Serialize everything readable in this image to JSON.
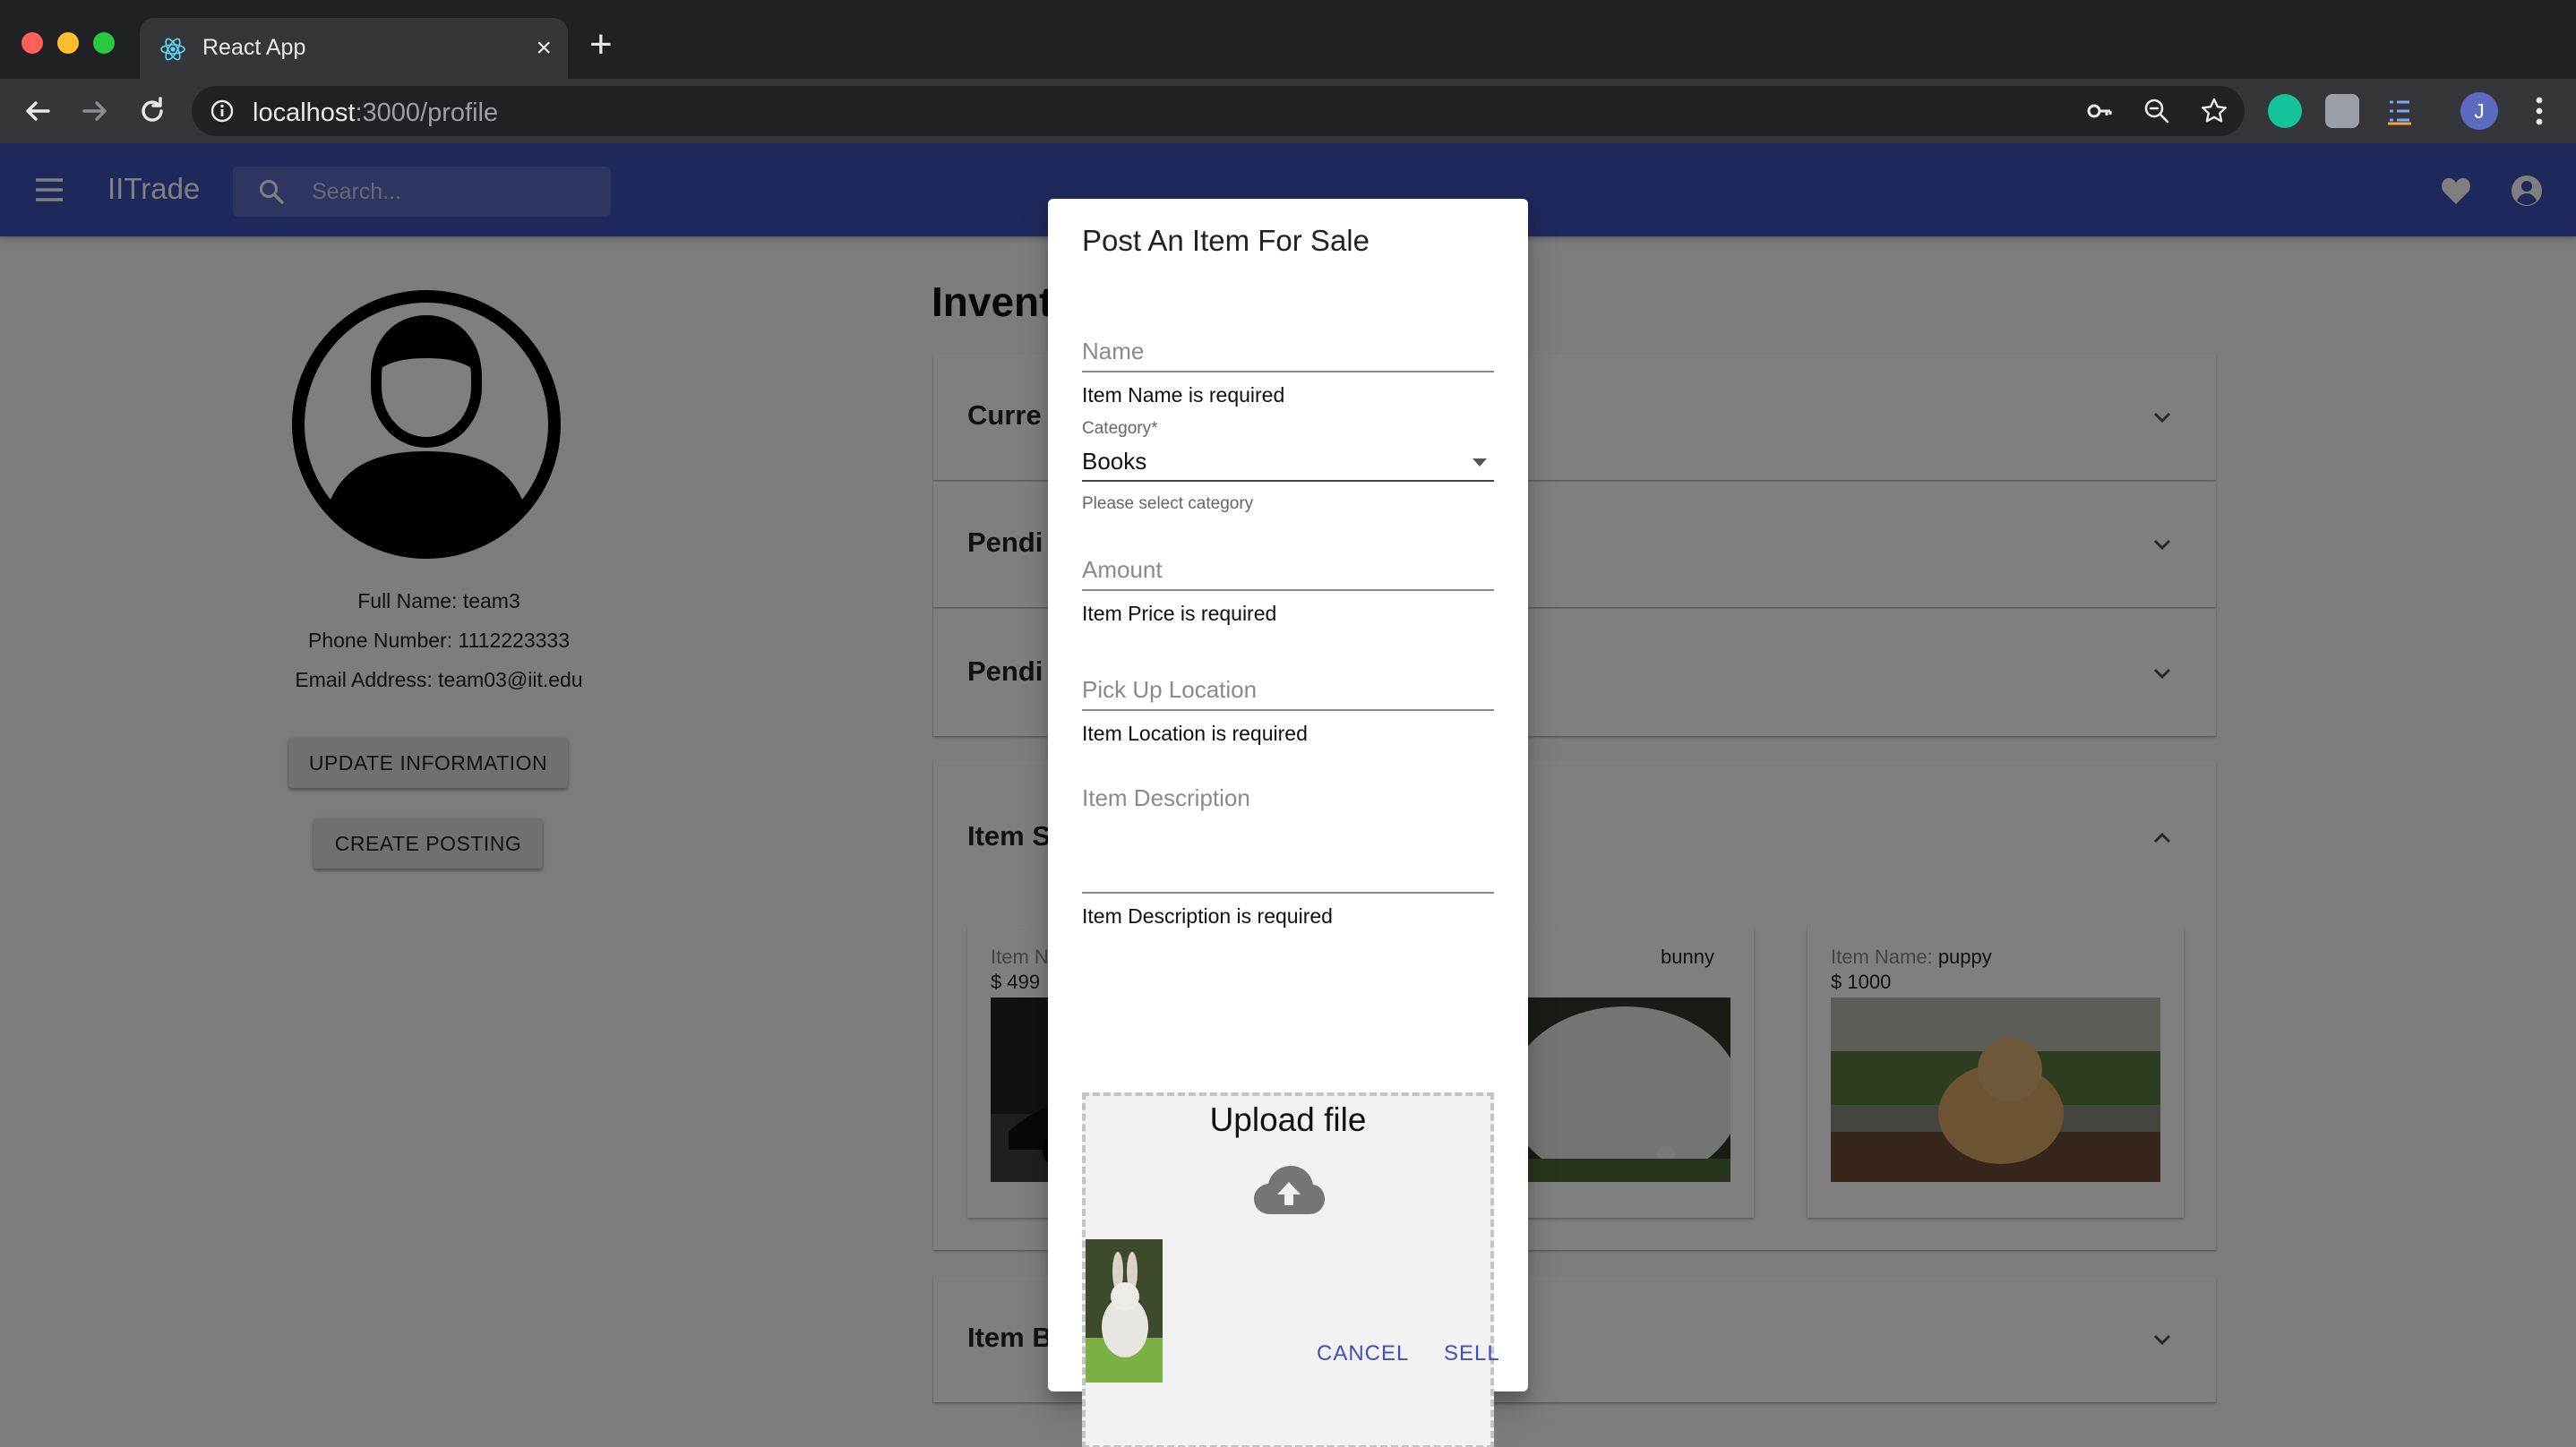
{
  "browser": {
    "tab_title": "React App",
    "tab_close": "×",
    "new_tab": "+",
    "url_host": "localhost",
    "url_path": ":3000/profile",
    "profile_initial": "J"
  },
  "app": {
    "brand": "IITrade",
    "search_placeholder": "Search..."
  },
  "profile": {
    "full_name": "Full Name: team3",
    "phone": "Phone Number: 1112223333",
    "email": "Email Address: team03@iit.edu",
    "update_button": "UPDATE INFORMATION",
    "create_button": "CREATE POSTING"
  },
  "inventory": {
    "title": "Invent",
    "panels": [
      "Curre",
      "Pendi",
      "Pendi",
      "Item S",
      "Item B"
    ],
    "cards": [
      {
        "name_label": "Item N",
        "name_value": "",
        "price_label": "$ ",
        "price_value": "499"
      },
      {
        "name_label": "",
        "name_value": "bunny",
        "price_label": "",
        "price_value": ""
      },
      {
        "name_label": "Item Name: ",
        "name_value": "puppy",
        "price_label": "$ ",
        "price_value": "1000"
      }
    ]
  },
  "dialog": {
    "title": "Post An Item For Sale",
    "name_placeholder": "Name",
    "name_error": "Item Name is required",
    "category_label": "Category",
    "category_required_mark": "*",
    "category_value": "Books",
    "category_helper": "Please select category",
    "amount_placeholder": "Amount",
    "amount_error": "Item Price is required",
    "location_placeholder": "Pick Up Location",
    "location_error": "Item Location is required",
    "description_placeholder": "Item Description",
    "description_error": "Item Description is required",
    "upload_title": "Upload file",
    "cancel": "CANCEL",
    "sell": "SELL"
  },
  "colors": {
    "appbar": "#3f51b5",
    "primary_text": "#3f51b5"
  }
}
